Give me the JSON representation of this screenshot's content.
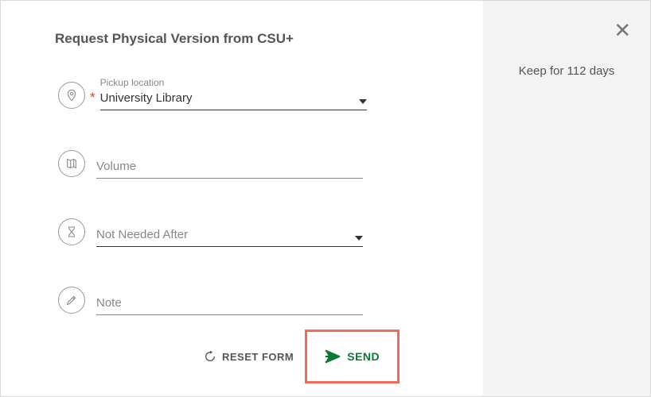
{
  "title": "Request Physical Version from CSU+",
  "side": {
    "keep_text": "Keep for 112 days"
  },
  "fields": {
    "pickup": {
      "label": "Pickup location",
      "value": "University Library"
    },
    "volume": {
      "placeholder": "Volume",
      "value": ""
    },
    "not_needed": {
      "placeholder": "Not Needed After",
      "value": ""
    },
    "note": {
      "placeholder": "Note",
      "value": ""
    }
  },
  "buttons": {
    "reset": "RESET FORM",
    "send": "SEND"
  },
  "icons": {
    "pin": "pin-icon",
    "book": "book-icon",
    "hourglass": "hourglass-icon",
    "pencil": "pencil-icon",
    "refresh": "refresh-icon",
    "send": "send-icon",
    "close": "close-icon"
  }
}
